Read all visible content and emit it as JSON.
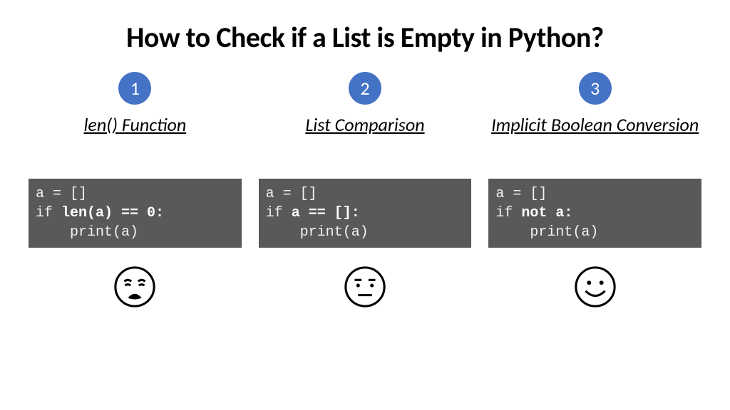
{
  "title": "How to Check if a List is Empty in Python?",
  "colors": {
    "badge_bg": "#4472C4",
    "code_bg": "#595959"
  },
  "columns": [
    {
      "number": "1",
      "heading": "len() Function",
      "code": {
        "line1": "a = []",
        "line2_prefix": "if ",
        "line2_bold": "len(a) == 0:",
        "line3": "    print(a)"
      },
      "emoji": "weary-face"
    },
    {
      "number": "2",
      "heading": "List Comparison",
      "code": {
        "line1": "a = []",
        "line2_prefix": "if ",
        "line2_bold": "a == []:",
        "line3": "    print(a)"
      },
      "emoji": "neutral-face"
    },
    {
      "number": "3",
      "heading": "Implicit Boolean Conversion",
      "code": {
        "line1": "a = []",
        "line2_prefix": "if ",
        "line2_bold": "not a:",
        "line3": "    print(a)"
      },
      "emoji": "smiling-face"
    }
  ]
}
